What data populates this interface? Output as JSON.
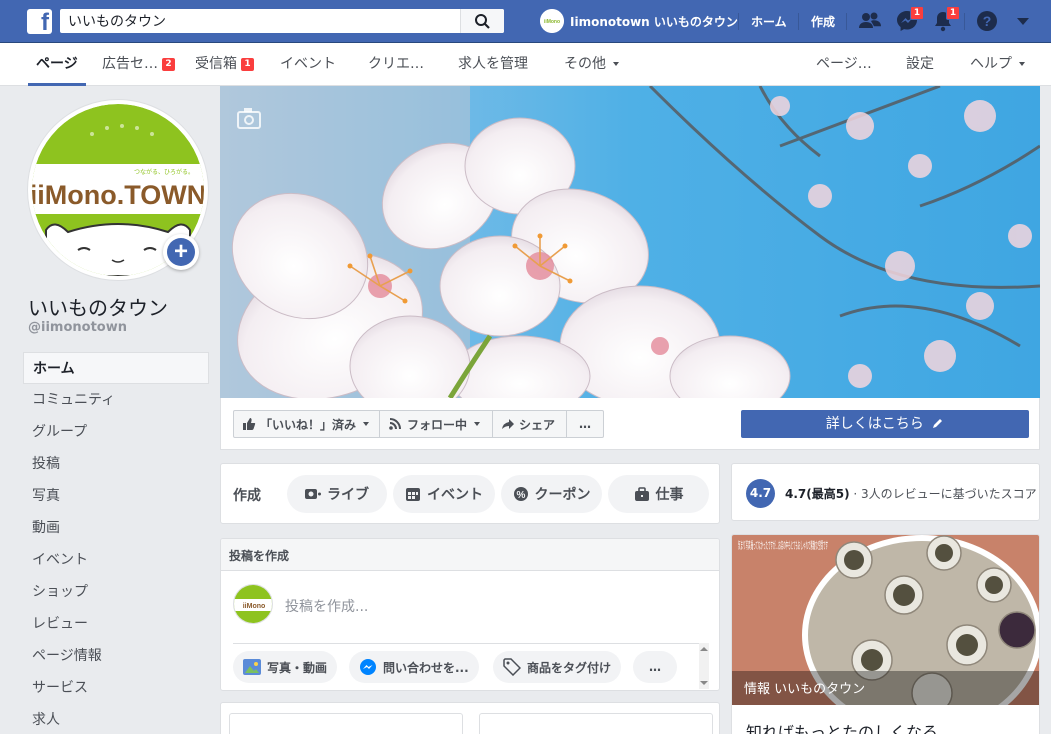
{
  "topbar": {
    "search_value": "いいものタウン",
    "profile_name": "Iimonotown いいものタウン",
    "home": "ホーム",
    "create": "作成",
    "messenger_badge": "1",
    "notif_badge": "1"
  },
  "subnav": {
    "tabs": [
      "ページ",
      "広告セ…",
      "受信箱",
      "イベント",
      "クリエ…",
      "求人を管理",
      "その他"
    ],
    "ads_badge": "2",
    "inbox_badge": "1",
    "right": [
      "ページ…",
      "設定",
      "ヘルプ"
    ]
  },
  "page": {
    "name": "いいものタウン",
    "handle": "@iimonotown",
    "logo_text": "iiMono.TOWN",
    "logo_tagline": "つながる、ひろがる。"
  },
  "leftnav": [
    "ホーム",
    "コミュニティ",
    "グループ",
    "投稿",
    "写真",
    "動画",
    "イベント",
    "ショップ",
    "レビュー",
    "ページ情報",
    "サービス",
    "求人"
  ],
  "actions": {
    "liked": "「いいね！」済み",
    "following": "フォロー中",
    "share": "シェア",
    "more": "…",
    "cta": "詳しくはこちら"
  },
  "create": {
    "label": "作成",
    "live": "ライブ",
    "event": "イベント",
    "coupon": "クーポン",
    "job": "仕事"
  },
  "composer": {
    "title": "投稿を作成",
    "placeholder": "投稿を作成...",
    "photo": "写真・動画",
    "message": "問い合わせを...",
    "tag": "商品をタグ付け",
    "more": "…"
  },
  "rating": {
    "score": "4.7",
    "bold": "4.7(最高5)",
    "text": "· 3人のレビューに基づいたスコア"
  },
  "info": {
    "overlay": "情報 いいものタウン",
    "handwritten": "気まり写真撮ってなかったですが…お店の中もとてもおしゃれで素敵な空間です",
    "headline": "知ればもっとたのしくなる。"
  }
}
